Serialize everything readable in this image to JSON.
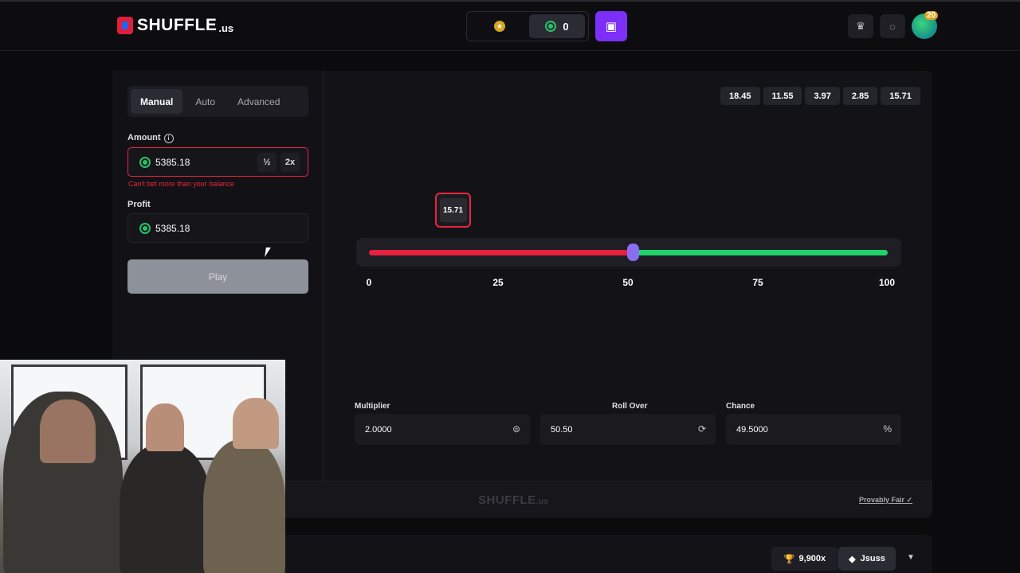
{
  "header": {
    "logo_text": "SHUFFLE",
    "logo_suffix": ".us",
    "balance": "0",
    "avatar_level": "20"
  },
  "tabs": [
    {
      "label": "Manual"
    },
    {
      "label": "Auto"
    },
    {
      "label": "Advanced"
    }
  ],
  "bet": {
    "amount_label": "Amount",
    "amount_value": "5385.18",
    "half_label": "½",
    "double_label": "2x",
    "error": "Can't bet more than your balance",
    "profit_label": "Profit",
    "profit_value": "5385.18",
    "play_label": "Play"
  },
  "history": [
    "18.45",
    "11.55",
    "3.97",
    "2.85",
    "15.71"
  ],
  "result": "15.71",
  "slider": {
    "value_fraction": 0.505,
    "ticks": [
      "0",
      "25",
      "50",
      "75",
      "100"
    ]
  },
  "stats": {
    "multiplier_label": "Multiplier",
    "multiplier_value": "2.0000",
    "rollover_label": "Roll Over",
    "rollover_value": "50.50",
    "chance_label": "Chance",
    "chance_value": "49.5000",
    "chance_suffix": "%"
  },
  "footer": {
    "logo": "SHUFFLE",
    "logo_suffix": ".us",
    "provably_fair": "Provably Fair"
  },
  "leaderboard": {
    "multiplier": "9,900x",
    "user": "Jsuss"
  },
  "colors": {
    "accent_purple": "#7b2ff7",
    "loss_red": "#e5213f",
    "win_green": "#22d36a",
    "coin_green": "#27c26b"
  }
}
